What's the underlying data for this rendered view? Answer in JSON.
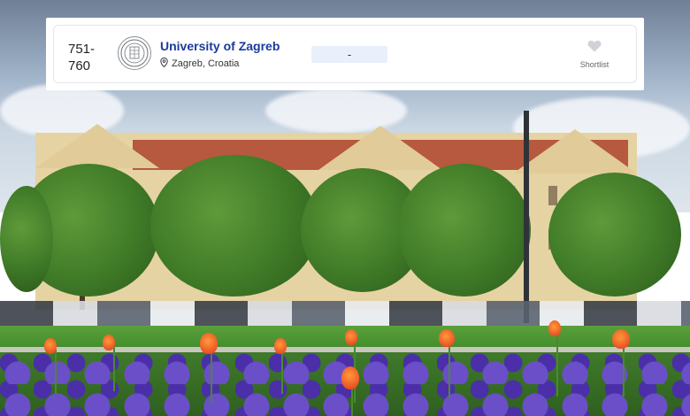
{
  "card": {
    "rank": "751-760",
    "university_name": "University of Zagreb",
    "location": "Zagreb, Croatia",
    "score_value": "-",
    "shortlist_label": "Shortlist",
    "icons": {
      "logo": "university-seal-icon",
      "location": "map-pin-icon",
      "shortlist": "heart-icon"
    },
    "colors": {
      "name_link": "#1a3a9c",
      "score_pill_bg": "#e9f0fb",
      "heart": "#cfd2d6"
    }
  }
}
